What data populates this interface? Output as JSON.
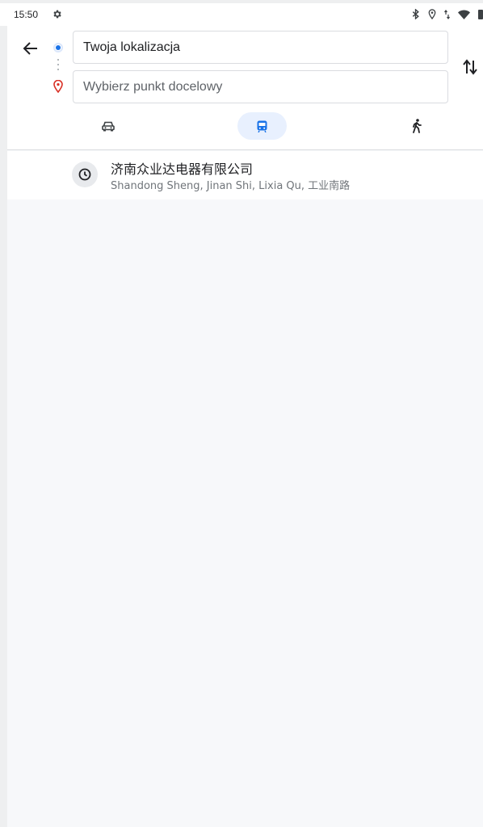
{
  "status_bar": {
    "time": "15:50",
    "icons": [
      "gear-icon",
      "bluetooth-icon",
      "location-icon",
      "data-arrows-icon",
      "wifi-icon",
      "battery-icon"
    ]
  },
  "directions": {
    "origin_value": "Twoja lokalizacja",
    "destination_placeholder": "Wybierz punkt docelowy",
    "modes": [
      {
        "name": "car",
        "icon": "car-icon",
        "selected": false
      },
      {
        "name": "transit",
        "icon": "train-icon",
        "selected": true
      },
      {
        "name": "walk",
        "icon": "walking-icon",
        "selected": false
      }
    ]
  },
  "history": [
    {
      "icon": "clock-icon",
      "title": "济南众业达电器有限公司",
      "subtitle": "Shandong Sheng, Jinan Shi, Lixia Qu, 工业南路"
    }
  ],
  "colors": {
    "accent_blue": "#1a73e8",
    "pin_red": "#d93025",
    "selected_mode_bg": "#e8f0fe",
    "background": "#f7f8fa"
  }
}
